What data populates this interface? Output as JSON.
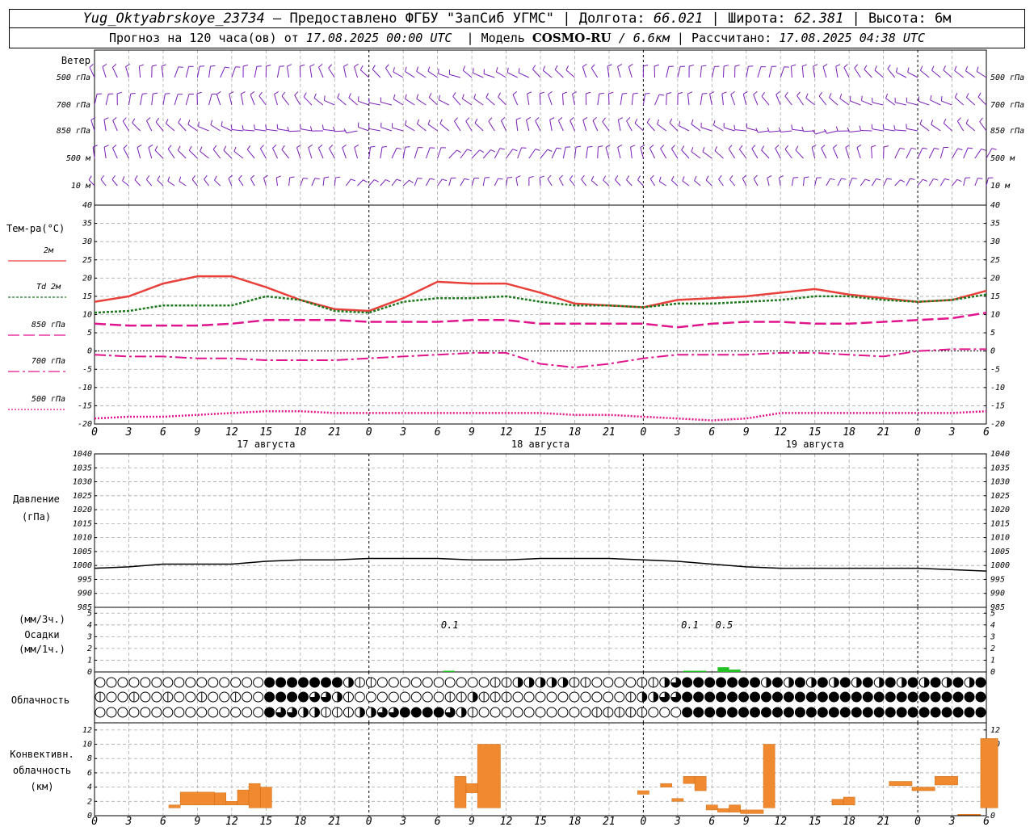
{
  "header": {
    "station": "Yug_Oktyabrskoye_23734",
    "provider": "– Предоставлено ФГБУ \"ЗапСиб УГМС\"",
    "lon_label": "Долгота:",
    "lon": "66.021",
    "lat_label": "Широта:",
    "lat": "62.381",
    "alt_label": "Высота:",
    "alt": "6м",
    "forecast_label": "Прогноз на 120 часа(ов) от",
    "forecast_start": "17.08.2025 00:00 UTC",
    "model_label": "Модель",
    "model": "COSMO-RU",
    "model_res": "/ 6.6км",
    "calc_label": "Рассчитано:",
    "calc_time": "17.08.2025 04:38 UTC"
  },
  "x_ticks": [
    "0",
    "3",
    "6",
    "9",
    "12",
    "15",
    "18",
    "21",
    "0",
    "3",
    "6",
    "9",
    "12",
    "15",
    "18",
    "21",
    "0",
    "3",
    "6",
    "9",
    "12",
    "15",
    "18",
    "21",
    "0",
    "3",
    "6"
  ],
  "date_labels": [
    {
      "hour": 15,
      "text": "17 августа"
    },
    {
      "hour": 39,
      "text": "18 августа"
    },
    {
      "hour": 63,
      "text": "19 августа"
    }
  ],
  "wind": {
    "title": "Ветер",
    "levels": [
      "500 гПа",
      "700 гПа",
      "850 гПа",
      "500 м",
      "10 м"
    ],
    "colors": "#7a1fb8"
  },
  "temperature": {
    "title": "Тем-ра(°С)",
    "legend": [
      {
        "label": "2м",
        "color": "#e8403a",
        "style": "solid"
      },
      {
        "label": "Td  2м",
        "color": "#1f7a1f",
        "style": "dot"
      },
      {
        "label": "850 гПа",
        "color": "#e0148c",
        "style": "dash"
      },
      {
        "label": "700 гПа",
        "color": "#e0148c",
        "style": "dashdot"
      },
      {
        "label": "500 гПа",
        "color": "#e0148c",
        "style": "fine"
      }
    ],
    "y_ticks": [
      "40",
      "35",
      "30",
      "25",
      "20",
      "15",
      "10",
      "5",
      "0",
      "-5",
      "-10",
      "-15",
      "-20"
    ]
  },
  "pressure": {
    "title": "Давление",
    "unit": "(гПа)",
    "y_ticks": [
      "1040",
      "1035",
      "1030",
      "1025",
      "1020",
      "1015",
      "1010",
      "1005",
      "1000",
      "995",
      "990",
      "985"
    ]
  },
  "precip": {
    "unit1": "(мм/3ч.)",
    "title": "Осадки",
    "unit2": "(мм/1ч.)",
    "y_ticks": [
      "5",
      "4",
      "3",
      "2",
      "1",
      "0"
    ],
    "annotations": [
      {
        "hour": 31,
        "text": "0.1"
      },
      {
        "hour": 52,
        "text": "0.1"
      },
      {
        "hour": 55,
        "text": "0.5"
      }
    ]
  },
  "cloud": {
    "title": "Облачность"
  },
  "convective": {
    "title1": "Конвективн.",
    "title2": "облачность",
    "unit": "(км)",
    "y_ticks": [
      "12",
      "10",
      "8",
      "6",
      "4",
      "2",
      "0"
    ]
  },
  "chart_data": [
    {
      "type": "line",
      "title": "Тем-ра(°С)",
      "xlabel": "",
      "ylabel": "Тем-ра(°С)",
      "ylim": [
        -20,
        40
      ],
      "x": [
        0,
        3,
        6,
        9,
        12,
        15,
        18,
        21,
        24,
        27,
        30,
        33,
        36,
        39,
        42,
        45,
        48,
        51,
        54,
        57,
        60,
        63,
        66,
        69,
        72,
        75,
        78
      ],
      "series": [
        {
          "name": "2м",
          "values": [
            13.5,
            15,
            18.5,
            20.5,
            20.5,
            17.5,
            14,
            11.5,
            11,
            14.5,
            19,
            18.5,
            18.5,
            16,
            13,
            12.5,
            12,
            14,
            14.5,
            15,
            16,
            17,
            15.5,
            14.5,
            13.5,
            14,
            16.5
          ]
        },
        {
          "name": "Td  2м",
          "values": [
            10.5,
            11,
            12.5,
            12.5,
            12.5,
            15,
            14,
            11,
            10.5,
            13.5,
            14.5,
            14.5,
            15,
            13.5,
            12.5,
            12.5,
            12,
            13,
            13,
            13.5,
            14,
            15,
            15,
            14,
            13.5,
            14,
            15.5
          ]
        },
        {
          "name": "850 гПа",
          "values": [
            7.5,
            7,
            7,
            7,
            7.5,
            8.5,
            8.5,
            8.5,
            8,
            8,
            8,
            8.5,
            8.5,
            7.5,
            7.5,
            7.5,
            7.5,
            6.5,
            7.5,
            8,
            8,
            7.5,
            7.5,
            8,
            8.5,
            9,
            10.5
          ]
        },
        {
          "name": "700 гПа",
          "values": [
            -1,
            -1.5,
            -1.5,
            -2,
            -2,
            -2.5,
            -2.5,
            -2.5,
            -2,
            -1.5,
            -1,
            -0.5,
            -0.5,
            -3.5,
            -4.5,
            -3.5,
            -2,
            -1,
            -1,
            -1,
            -0.5,
            -0.5,
            -1,
            -1.5,
            0,
            0.5,
            0.5
          ]
        },
        {
          "name": "500 гПа",
          "values": [
            -18.5,
            -18,
            -18,
            -17.5,
            -17,
            -16.5,
            -16.5,
            -17,
            -17,
            -17,
            -17,
            -17,
            -17,
            -17,
            -17.5,
            -17.5,
            -18,
            -18.5,
            -19,
            -18.5,
            -17,
            -17,
            -17,
            -17,
            -17,
            -17,
            -16.5
          ]
        }
      ]
    },
    {
      "type": "line",
      "title": "Давление",
      "ylabel": "(гПа)",
      "ylim": [
        985,
        1040
      ],
      "x": [
        0,
        3,
        6,
        9,
        12,
        15,
        18,
        21,
        24,
        27,
        30,
        33,
        36,
        39,
        42,
        45,
        48,
        51,
        54,
        57,
        60,
        63,
        66,
        69,
        72,
        75,
        78
      ],
      "series": [
        {
          "values": [
            999,
            999.5,
            1000.5,
            1000.5,
            1000.5,
            1001.5,
            1002,
            1002,
            1002.5,
            1002.5,
            1002.5,
            1002,
            1002,
            1002.5,
            1002.5,
            1002.5,
            1002,
            1001.5,
            1000.5,
            999.5,
            999,
            999,
            999,
            999,
            999,
            998.5,
            998
          ]
        }
      ]
    },
    {
      "type": "bar",
      "title": "Осадки",
      "ylabel": "(мм/1ч.)",
      "ylim": [
        0,
        5
      ],
      "bars": [
        {
          "hour": 31,
          "value": 0.1
        },
        {
          "hour": 52,
          "value": 0.1
        },
        {
          "hour": 53,
          "value": 0.1
        },
        {
          "hour": 55,
          "value": 0.4
        },
        {
          "hour": 56,
          "value": 0.2
        }
      ]
    },
    {
      "type": "bar",
      "title": "Конвективн. облачность",
      "ylabel": "(км)",
      "ylim": [
        0,
        13
      ],
      "ranges": [
        {
          "h0": 6.5,
          "h1": 7.5,
          "lo": 1.1,
          "hi": 1.5
        },
        {
          "h0": 7.5,
          "h1": 10.5,
          "lo": 1.5,
          "hi": 3.3
        },
        {
          "h0": 10.5,
          "h1": 11.5,
          "lo": 1.5,
          "hi": 3.2
        },
        {
          "h0": 11.5,
          "h1": 12.5,
          "lo": 1.5,
          "hi": 2.0
        },
        {
          "h0": 12.5,
          "h1": 13.5,
          "lo": 1.5,
          "hi": 3.6
        },
        {
          "h0": 13.5,
          "h1": 14.5,
          "lo": 1.1,
          "hi": 4.5
        },
        {
          "h0": 14.5,
          "h1": 15.5,
          "lo": 1.1,
          "hi": 4.0
        },
        {
          "h0": 31.5,
          "h1": 32.5,
          "lo": 1.1,
          "hi": 5.5
        },
        {
          "h0": 32.5,
          "h1": 33.5,
          "lo": 3.2,
          "hi": 4.5
        },
        {
          "h0": 33.5,
          "h1": 35.5,
          "lo": 1.1,
          "hi": 10.0
        },
        {
          "h0": 47.5,
          "h1": 48.5,
          "lo": 3.0,
          "hi": 3.5
        },
        {
          "h0": 49.5,
          "h1": 50.5,
          "lo": 4.0,
          "hi": 4.5
        },
        {
          "h0": 50.5,
          "h1": 51.5,
          "lo": 2.0,
          "hi": 2.4
        },
        {
          "h0": 51.5,
          "h1": 52.5,
          "lo": 4.5,
          "hi": 5.5
        },
        {
          "h0": 52.5,
          "h1": 53.5,
          "lo": 3.5,
          "hi": 5.5
        },
        {
          "h0": 53.5,
          "h1": 54.5,
          "lo": 0.8,
          "hi": 1.5
        },
        {
          "h0": 54.5,
          "h1": 55.5,
          "lo": 0.5,
          "hi": 1.0
        },
        {
          "h0": 55.5,
          "h1": 56.5,
          "lo": 0.5,
          "hi": 1.5
        },
        {
          "h0": 56.5,
          "h1": 58.5,
          "lo": 0.3,
          "hi": 0.8
        },
        {
          "h0": 58.5,
          "h1": 59.5,
          "lo": 1.1,
          "hi": 10.0
        },
        {
          "h0": 64.5,
          "h1": 65.5,
          "lo": 1.5,
          "hi": 2.3
        },
        {
          "h0": 65.5,
          "h1": 66.5,
          "lo": 1.5,
          "hi": 2.6
        },
        {
          "h0": 69.5,
          "h1": 71.5,
          "lo": 4.2,
          "hi": 4.8
        },
        {
          "h0": 71.5,
          "h1": 73.5,
          "lo": 3.5,
          "hi": 4.0
        },
        {
          "h0": 73.5,
          "h1": 75.5,
          "lo": 4.3,
          "hi": 5.5
        },
        {
          "h0": 75.5,
          "h1": 77.5,
          "lo": 0.1,
          "hi": 0.2
        },
        {
          "h0": 77.5,
          "h1": 79,
          "lo": 1.1,
          "hi": 10.8
        }
      ]
    }
  ]
}
